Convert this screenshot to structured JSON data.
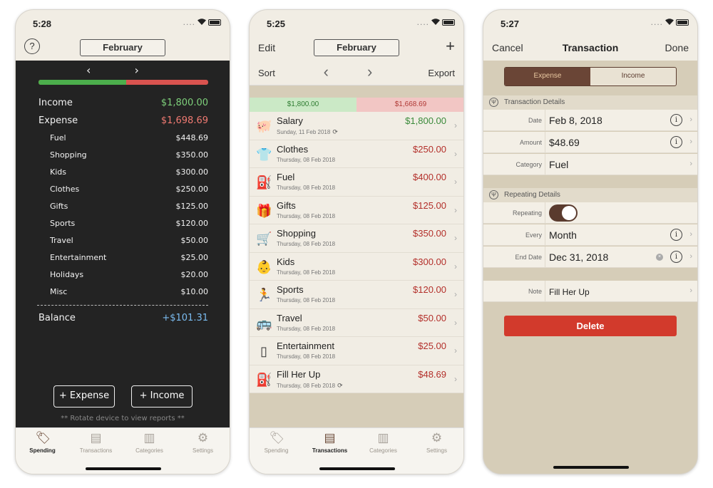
{
  "screen1": {
    "status_time": "5:28",
    "help_label": "?",
    "month": "February",
    "arrows": "‹ ›",
    "income_ratio": 0.515,
    "income": {
      "label": "Income",
      "value": "$1,800.00"
    },
    "expense": {
      "label": "Expense",
      "value": "$1,698.69"
    },
    "categories": [
      {
        "label": "Fuel",
        "value": "$448.69"
      },
      {
        "label": "Shopping",
        "value": "$350.00"
      },
      {
        "label": "Kids",
        "value": "$300.00"
      },
      {
        "label": "Clothes",
        "value": "$250.00"
      },
      {
        "label": "Gifts",
        "value": "$125.00"
      },
      {
        "label": "Sports",
        "value": "$120.00"
      },
      {
        "label": "Travel",
        "value": "$50.00"
      },
      {
        "label": "Entertainment",
        "value": "$25.00"
      },
      {
        "label": "Holidays",
        "value": "$20.00"
      },
      {
        "label": "Misc",
        "value": "$10.00"
      }
    ],
    "balance": {
      "label": "Balance",
      "value": "+$101.31"
    },
    "add_expense": "+ Expense",
    "add_income": "+ Income",
    "hint": "** Rotate device to view reports **"
  },
  "tabs": [
    {
      "label": "Spending",
      "icon": "tag-icon",
      "glyph": "🏷"
    },
    {
      "label": "Transactions",
      "icon": "ledger-icon",
      "glyph": "▤"
    },
    {
      "label": "Categories",
      "icon": "cabinet-icon",
      "glyph": "▥"
    },
    {
      "label": "Settings",
      "icon": "gear-icon",
      "glyph": "⚙"
    }
  ],
  "screen2": {
    "status_time": "5:25",
    "edit": "Edit",
    "month": "February",
    "plus": "+",
    "sort": "Sort",
    "arrows": "‹ ›",
    "export": "Export",
    "income_total": "$1,800.00",
    "expense_total": "$1,668.69",
    "transactions": [
      {
        "name": "Salary",
        "date": "Sunday, 11 Feb 2018",
        "amount": "$1,800.00",
        "type": "income",
        "icon": "piggy-bank-icon",
        "glyph": "🐖",
        "repeat": true
      },
      {
        "name": "Clothes",
        "date": "Thursday, 08 Feb 2018",
        "amount": "$250.00",
        "type": "expense",
        "icon": "shirt-icon",
        "glyph": "👕",
        "repeat": false
      },
      {
        "name": "Fuel",
        "date": "Thursday, 08 Feb 2018",
        "amount": "$400.00",
        "type": "expense",
        "icon": "fuel-pump-icon",
        "glyph": "⛽",
        "repeat": false
      },
      {
        "name": "Gifts",
        "date": "Thursday, 08 Feb 2018",
        "amount": "$125.00",
        "type": "expense",
        "icon": "gift-icon",
        "glyph": "🎁",
        "repeat": false
      },
      {
        "name": "Shopping",
        "date": "Thursday, 08 Feb 2018",
        "amount": "$350.00",
        "type": "expense",
        "icon": "cart-icon",
        "glyph": "🛒",
        "repeat": false
      },
      {
        "name": "Kids",
        "date": "Thursday, 08 Feb 2018",
        "amount": "$300.00",
        "type": "expense",
        "icon": "baby-icon",
        "glyph": "👶",
        "repeat": false
      },
      {
        "name": "Sports",
        "date": "Thursday, 08 Feb 2018",
        "amount": "$120.00",
        "type": "expense",
        "icon": "runner-icon",
        "glyph": "🏃",
        "repeat": false
      },
      {
        "name": "Travel",
        "date": "Thursday, 08 Feb 2018",
        "amount": "$50.00",
        "type": "expense",
        "icon": "bus-icon",
        "glyph": "🚌",
        "repeat": false
      },
      {
        "name": "Entertainment",
        "date": "Thursday, 08 Feb 2018",
        "amount": "$25.00",
        "type": "expense",
        "icon": "media-player-icon",
        "glyph": "▯",
        "repeat": false
      },
      {
        "name": "Fill Her Up",
        "date": "Thursday, 08 Feb 2018",
        "amount": "$48.69",
        "type": "expense",
        "icon": "fuel-pump-icon",
        "glyph": "⛽",
        "repeat": true
      }
    ]
  },
  "screen3": {
    "status_time": "5:27",
    "cancel": "Cancel",
    "title": "Transaction",
    "done": "Done",
    "segment_expense": "Expense",
    "segment_income": "Income",
    "details_header": "Transaction Details",
    "date_label": "Date",
    "date_value": "Feb 8, 2018",
    "amount_label": "Amount",
    "amount_value": "$48.69",
    "category_label": "Category",
    "category_value": "Fuel",
    "repeating_header": "Repeating Details",
    "repeating_label": "Repeating",
    "repeating_on": true,
    "every_label": "Every",
    "every_value": "Month",
    "end_label": "End Date",
    "end_value": "Dec 31, 2018",
    "note_label": "Note",
    "note_value": "Fill Her Up",
    "delete": "Delete"
  },
  "colors": {
    "income_green": "#4cae4c",
    "expense_red": "#d9534f",
    "chalkboard": "#232323",
    "brown_accent": "#5a3b2e",
    "delete_red": "#d23a2c"
  }
}
